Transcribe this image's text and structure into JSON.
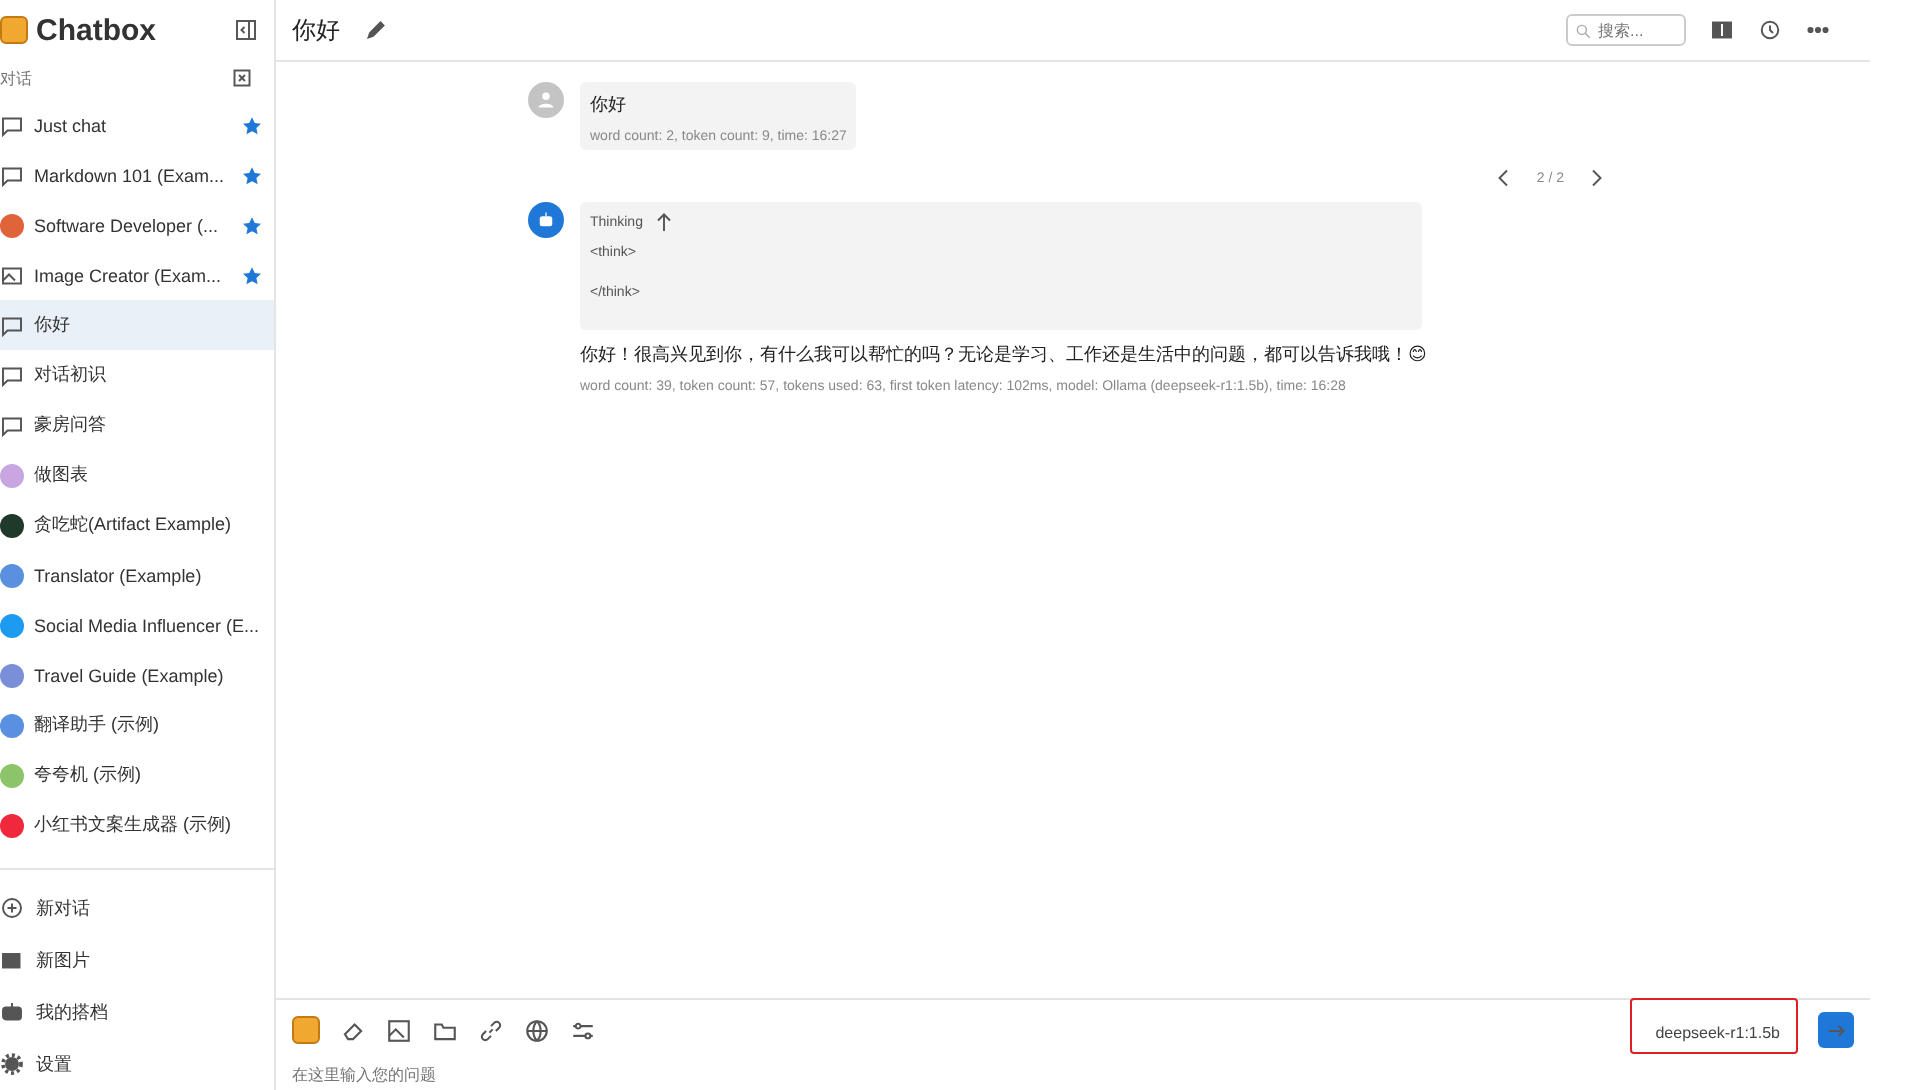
{
  "app": {
    "title": "Chatbox"
  },
  "sidebar": {
    "section_label": "对话",
    "items": [
      {
        "label": "Just chat",
        "kind": "chat",
        "starred": true,
        "selected": false
      },
      {
        "label": "Markdown 101 (Exam...",
        "kind": "chat",
        "starred": true,
        "selected": false
      },
      {
        "label": "Software Developer (...",
        "kind": "avatar",
        "color": "#e0643a",
        "starred": true,
        "selected": false
      },
      {
        "label": "Image Creator (Exam...",
        "kind": "image",
        "starred": true,
        "selected": false
      },
      {
        "label": "你好",
        "kind": "chat",
        "starred": false,
        "selected": true
      },
      {
        "label": "对话初识",
        "kind": "chat",
        "starred": false,
        "selected": false
      },
      {
        "label": "豪房问答",
        "kind": "chat",
        "starred": false,
        "selected": false
      },
      {
        "label": "做图表",
        "kind": "avatar",
        "color": "#c9a6e0",
        "starred": false,
        "selected": false
      },
      {
        "label": "贪吃蛇(Artifact Example)",
        "kind": "avatar",
        "color": "#1f3a2a",
        "starred": false,
        "selected": false
      },
      {
        "label": "Translator (Example)",
        "kind": "avatar",
        "color": "#5b8fe0",
        "starred": false,
        "selected": false
      },
      {
        "label": "Social Media Influencer (E...",
        "kind": "avatar",
        "color": "#1d9bf0",
        "starred": false,
        "selected": false
      },
      {
        "label": "Travel Guide (Example)",
        "kind": "avatar",
        "color": "#7a8fd8",
        "starred": false,
        "selected": false
      },
      {
        "label": "翻译助手 (示例)",
        "kind": "avatar",
        "color": "#5b8fe0",
        "starred": false,
        "selected": false
      },
      {
        "label": "夸夸机 (示例)",
        "kind": "avatar",
        "color": "#8cc46a",
        "starred": false,
        "selected": false
      },
      {
        "label": "小红书文案生成器 (示例)",
        "kind": "avatar",
        "color": "#f0283c",
        "starred": false,
        "selected": false
      }
    ],
    "actions": [
      {
        "label": "新对话",
        "kind": "plus"
      },
      {
        "label": "新图片",
        "kind": "image"
      },
      {
        "label": "我的搭档",
        "kind": "robot"
      },
      {
        "label": "设置",
        "kind": "gear"
      }
    ]
  },
  "header": {
    "title": "你好",
    "search": {
      "placeholder": "搜索..."
    }
  },
  "messages": [
    {
      "kind": "user",
      "text": "你好",
      "meta": "word count: 2, token count: 9, time: 16:27"
    },
    {
      "kind": "assistant",
      "pager": "2 / 2",
      "thinking": {
        "label": "Thinking",
        "lines": [
          "<think>",
          "</think>"
        ]
      },
      "text": "你好！很高兴见到你，有什么我可以帮忙的吗？无论是学习、工作还是生活中的问题，都可以告诉我哦！😊",
      "meta": "word count: 39, token count: 57, tokens used: 63, first token latency: 102ms, model: Ollama (deepseek-r1:1.5b), time: 16:28"
    }
  ],
  "composer": {
    "model": "deepseek-r1:1.5b",
    "placeholder": "在这里输入您的问题"
  }
}
